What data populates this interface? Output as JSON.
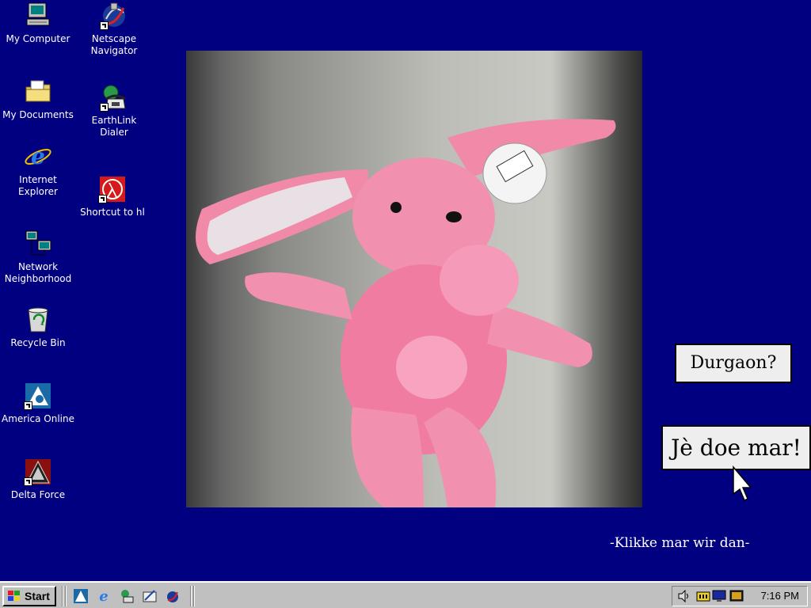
{
  "desktop_icons": [
    {
      "label": "My Computer",
      "icon": "computer-icon"
    },
    {
      "label": "My Documents",
      "icon": "folder-icon"
    },
    {
      "label": "Internet Explorer",
      "icon": "ie-icon"
    },
    {
      "label": "Network Neighborhood",
      "icon": "network-icon"
    },
    {
      "label": "Recycle Bin",
      "icon": "recycle-bin-icon"
    },
    {
      "label": "America Online",
      "icon": "aol-icon"
    },
    {
      "label": "Delta Force",
      "icon": "delta-force-icon"
    },
    {
      "label": "Netscape Navigator",
      "icon": "netscape-icon"
    },
    {
      "label": "EarthLink Dialer",
      "icon": "phone-icon"
    },
    {
      "label": "Shortcut to hl",
      "icon": "half-life-icon"
    }
  ],
  "slide": {
    "question_label": "Durgaon?",
    "answer_label": "Jè doe mar!",
    "footer_text": "-Klikke mar wir dan-"
  },
  "taskbar": {
    "start_label": "Start",
    "clock": "7:16 PM",
    "quick_launch": [
      "aol-icon",
      "ie-icon",
      "earthlink-icon",
      "outlook-icon",
      "netscape-icon"
    ],
    "tray_icons": [
      "volume-icon",
      "battery-icon",
      "display-icon",
      "screen-icon"
    ]
  },
  "colors": {
    "desktop": "#000080",
    "taskbar": "#c0c0c0"
  }
}
